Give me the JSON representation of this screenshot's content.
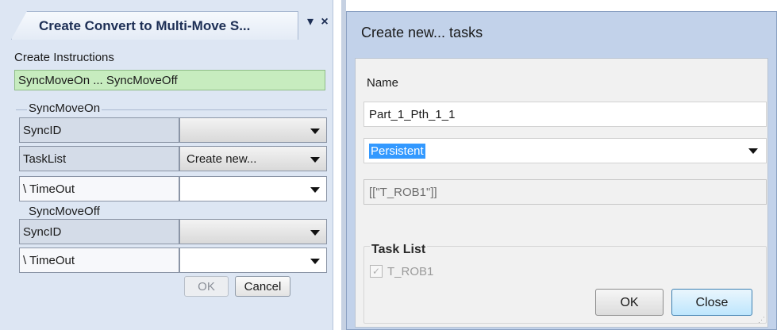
{
  "left_panel": {
    "tab_title": "Create Convert to  Multi-Move S...",
    "pin_glyph": "▾",
    "close_glyph": "×",
    "create_instructions_label": "Create Instructions",
    "selected_instruction": "SyncMoveOn ... SyncMoveOff",
    "group1": {
      "title": "SyncMoveOn",
      "rows": [
        {
          "label": "SyncID",
          "value": ""
        },
        {
          "label": "TaskList",
          "value": "Create new..."
        },
        {
          "label": "\\ TimeOut",
          "value": ""
        }
      ]
    },
    "group2": {
      "title": "SyncMoveOff",
      "rows": [
        {
          "label": "SyncID",
          "value": ""
        },
        {
          "label": "\\ TimeOut",
          "value": ""
        }
      ]
    },
    "ok_label": "OK",
    "cancel_label": "Cancel"
  },
  "dialog": {
    "title": "Create new... tasks",
    "name_label": "Name",
    "name_value": "Part_1_Pth_1_1",
    "storage_selected": "Persistent",
    "task_value": "[[\"T_ROB1\"]]",
    "task_list_title": "Task List",
    "task_list_items": [
      {
        "label": "T_ROB1",
        "checked": true
      }
    ],
    "ok_label": "OK",
    "close_label": "Close"
  },
  "icons": {
    "dropdown": "chevron-down-icon",
    "pin": "pin-dropdown-icon",
    "close": "close-icon",
    "check": "check-icon",
    "grip": "resize-grip-icon"
  },
  "colors": {
    "panel_bg": "#dde6f3",
    "selected_instruction_bg": "#c7ecbf",
    "dialog_frame": "#c2d2ea",
    "selection_highlight": "#3399ff",
    "primary_button": "#bee6fd"
  }
}
